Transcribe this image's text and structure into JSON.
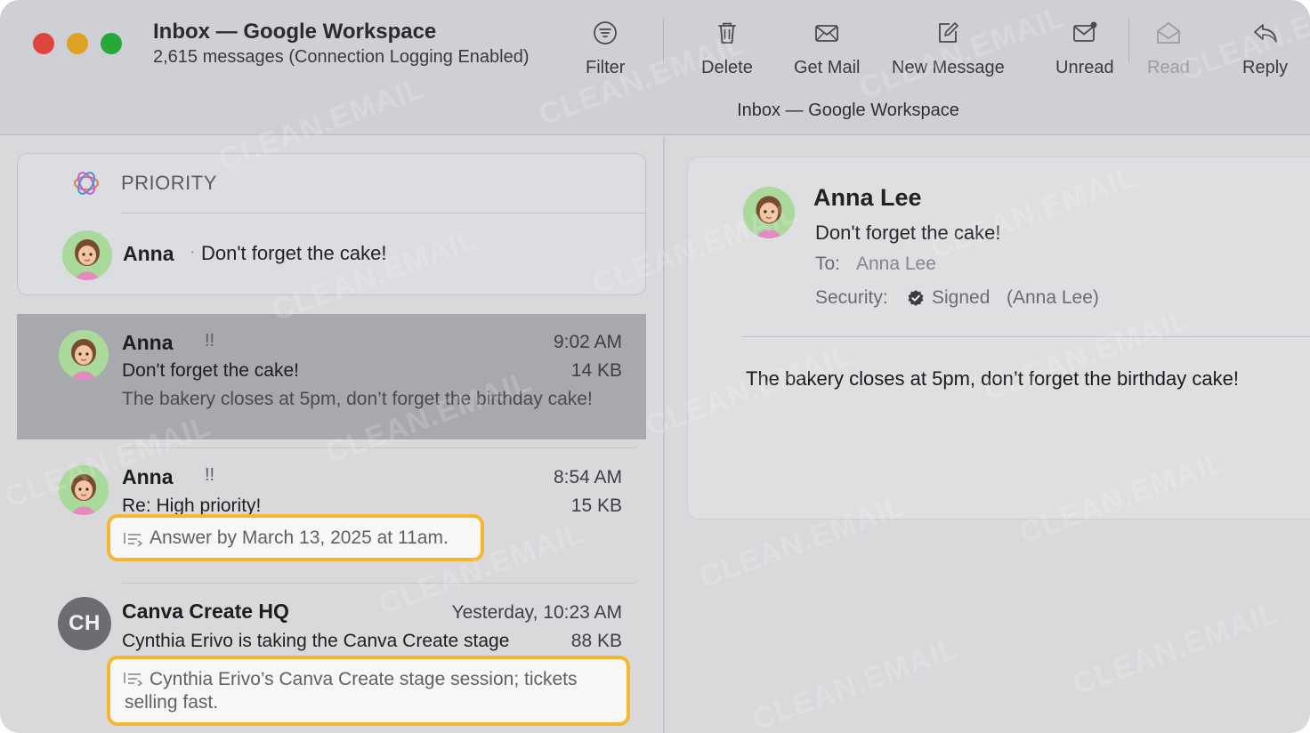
{
  "window": {
    "title": "Inbox — Google Workspace",
    "subtitle": "2,615 messages (Connection Logging Enabled)",
    "mailbox_path": "Inbox — Google Workspace"
  },
  "toolbar": {
    "filter": "Filter",
    "delete": "Delete",
    "get_mail": "Get Mail",
    "new_message": "New Message",
    "unread": "Unread",
    "read": "Read",
    "reply": "Reply"
  },
  "priority": {
    "label": "PRIORITY",
    "item": {
      "sender": "Anna",
      "separator": "·",
      "subject": "Don't forget the cake!"
    }
  },
  "messages": [
    {
      "sender": "Anna",
      "flag": "!!",
      "time": "9:02 AM",
      "subject": "Don't forget the cake!",
      "size": "14 KB",
      "preview": "The bakery closes at 5pm, don’t forget the birthday cake!"
    },
    {
      "sender": "Anna",
      "flag": "!!",
      "time": "8:54 AM",
      "subject": "Re: High priority!",
      "size": "15 KB",
      "summary": "Answer by March 13, 2025 at 11am."
    },
    {
      "sender": "Canva Create HQ",
      "initials": "CH",
      "time": "Yesterday, 10:23 AM",
      "subject": "Cynthia Erivo is taking the Canva Create stage",
      "size": "88 KB",
      "summary": "Cynthia Erivo’s Canva Create stage session; tickets selling fast."
    }
  ],
  "reader": {
    "from": "Anna Lee",
    "subject": "Don't forget the cake!",
    "to_label": "To:",
    "to": "Anna Lee",
    "security_label": "Security:",
    "security_status": "Signed",
    "security_signer": "(Anna Lee)",
    "body": "The bakery closes at 5pm, don’t forget the birthday cake!"
  },
  "watermark": "CLEAN.EMAIL",
  "colors": {
    "highlight_border": "#f5b731",
    "traffic_red": "#e0443e",
    "traffic_yellow": "#dea123",
    "traffic_green": "#27a93a",
    "selected_row": "#a8a9ad"
  }
}
